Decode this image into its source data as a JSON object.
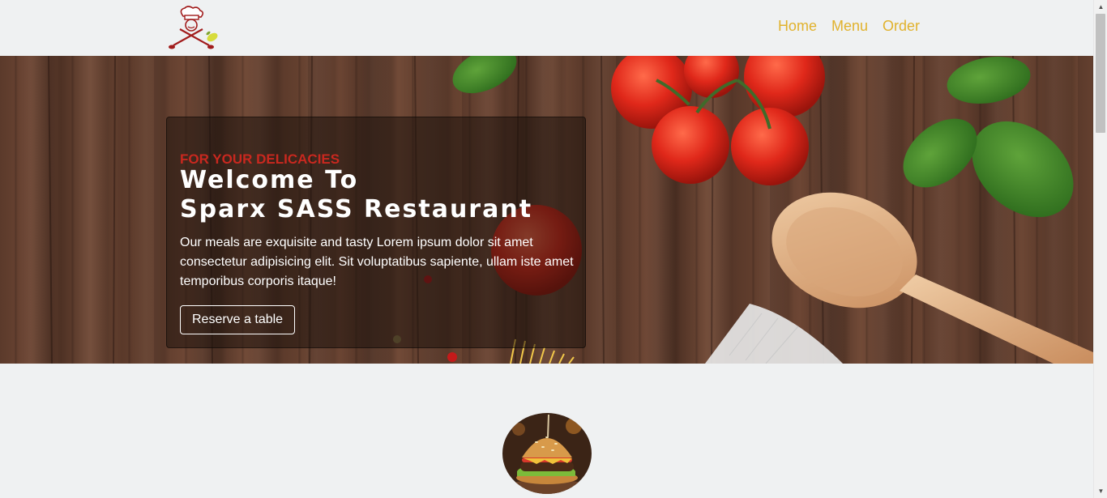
{
  "nav": {
    "links": [
      "Home",
      "Menu",
      "Order"
    ]
  },
  "hero": {
    "kicker": "FOR YOUR DELICACIES",
    "title_line1": "Welcome To",
    "title_line2": "Sparx SASS Restaurant",
    "text": "Our meals are exquisite and tasty Lorem ipsum dolor sit amet consectetur adipisicing elit. Sit voluptatibus sapiente, ullam iste amet temporibus corporis itaque!",
    "button_label": "Reserve a table"
  },
  "colors": {
    "accent": "#e1b22d",
    "kicker": "#c9281f",
    "background": "#eff1f2"
  },
  "icons": {
    "logo": "chef-logo-icon",
    "scroll_up": "scroll-up-icon",
    "scroll_down": "scroll-down-icon"
  }
}
